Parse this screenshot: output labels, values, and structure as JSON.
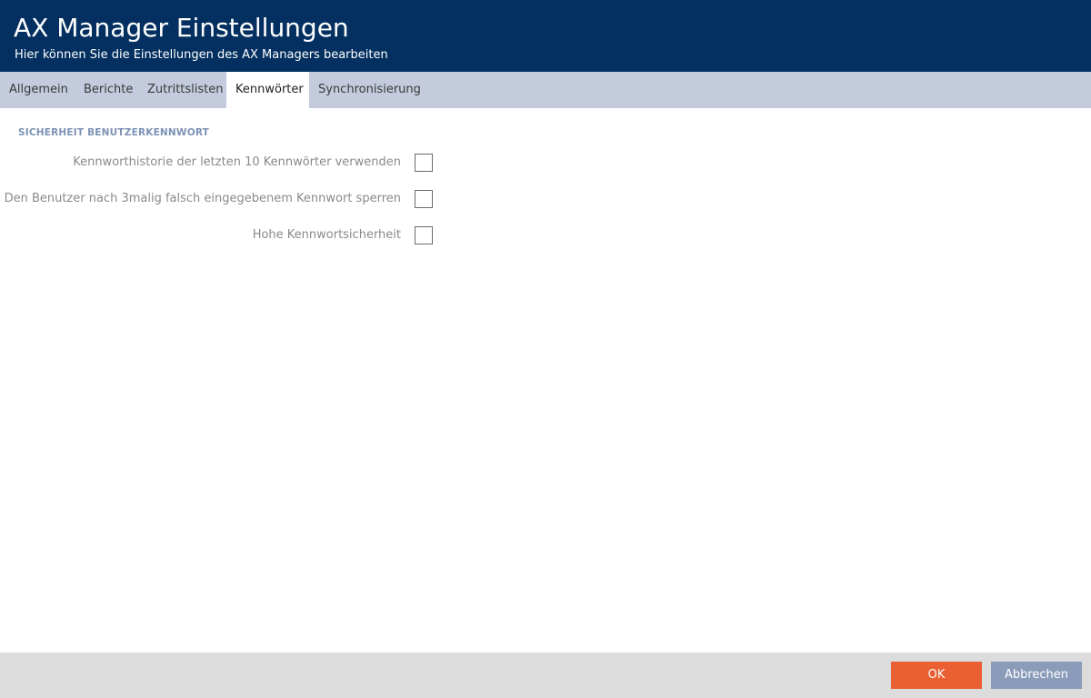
{
  "header": {
    "title": "AX Manager Einstellungen",
    "subtitle": "Hier können Sie die Einstellungen des AX Managers bearbeiten"
  },
  "tabs": [
    {
      "label": "Allgemein",
      "active": false
    },
    {
      "label": "Berichte",
      "active": false
    },
    {
      "label": "Zutrittslisten",
      "active": false
    },
    {
      "label": "Kennwörter",
      "active": true
    },
    {
      "label": "Synchronisierung",
      "active": false
    }
  ],
  "section": {
    "title": "SICHERHEIT BENUTZERKENNWORT",
    "options": [
      {
        "label": "Kennworthistorie der letzten 10 Kennwörter verwenden",
        "checked": false
      },
      {
        "label": "Den Benutzer nach 3malig falsch eingegebenem Kennwort sperren",
        "checked": false
      },
      {
        "label": "Hohe Kennwortsicherheit",
        "checked": false
      }
    ]
  },
  "footer": {
    "ok_label": "OK",
    "cancel_label": "Abbrechen"
  },
  "colors": {
    "header_bg": "#033060",
    "tabbar_bg": "#c3cbdd",
    "section_title": "#7d92b5",
    "ok_button": "#eb6033",
    "cancel_button": "#8a9cba",
    "footer_bg": "#dcdcdc"
  }
}
